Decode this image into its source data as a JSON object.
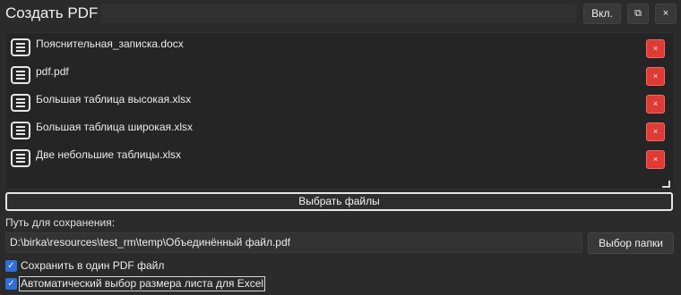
{
  "window": {
    "title": "Создать PDF",
    "buttons": {
      "toggle": "Вкл.",
      "duplicate": "⧉",
      "close": "×"
    }
  },
  "files": [
    {
      "name": "Пояснительная_записка.docx",
      "icon": "document-lines-icon",
      "remove": "×"
    },
    {
      "name": "pdf.pdf",
      "icon": "document-lines-icon",
      "remove": "×"
    },
    {
      "name": "Большая таблица высокая.xlsx",
      "icon": "document-lines-icon",
      "remove": "×"
    },
    {
      "name": "Большая таблица широкая.xlsx",
      "icon": "document-lines-icon",
      "remove": "×"
    },
    {
      "name": "Две небольшие таблицы.xlsx",
      "icon": "document-lines-icon",
      "remove": "×"
    }
  ],
  "select_files_label": "Выбрать файлы",
  "save_path": {
    "label": "Путь для сохранения:",
    "value": "D:\\birka\\resources\\test_rm\\temp\\Объединённый файл.pdf",
    "browse_label": "Выбор папки"
  },
  "options": [
    {
      "label": "Сохранить в один PDF файл",
      "checked": true
    },
    {
      "label": "Автоматический выбор размера листа для Excel",
      "checked": true,
      "focused": true
    }
  ],
  "colors": {
    "background": "#2b2b2b",
    "delete": "#e03a35",
    "checkbox": "#2d6fd6"
  }
}
